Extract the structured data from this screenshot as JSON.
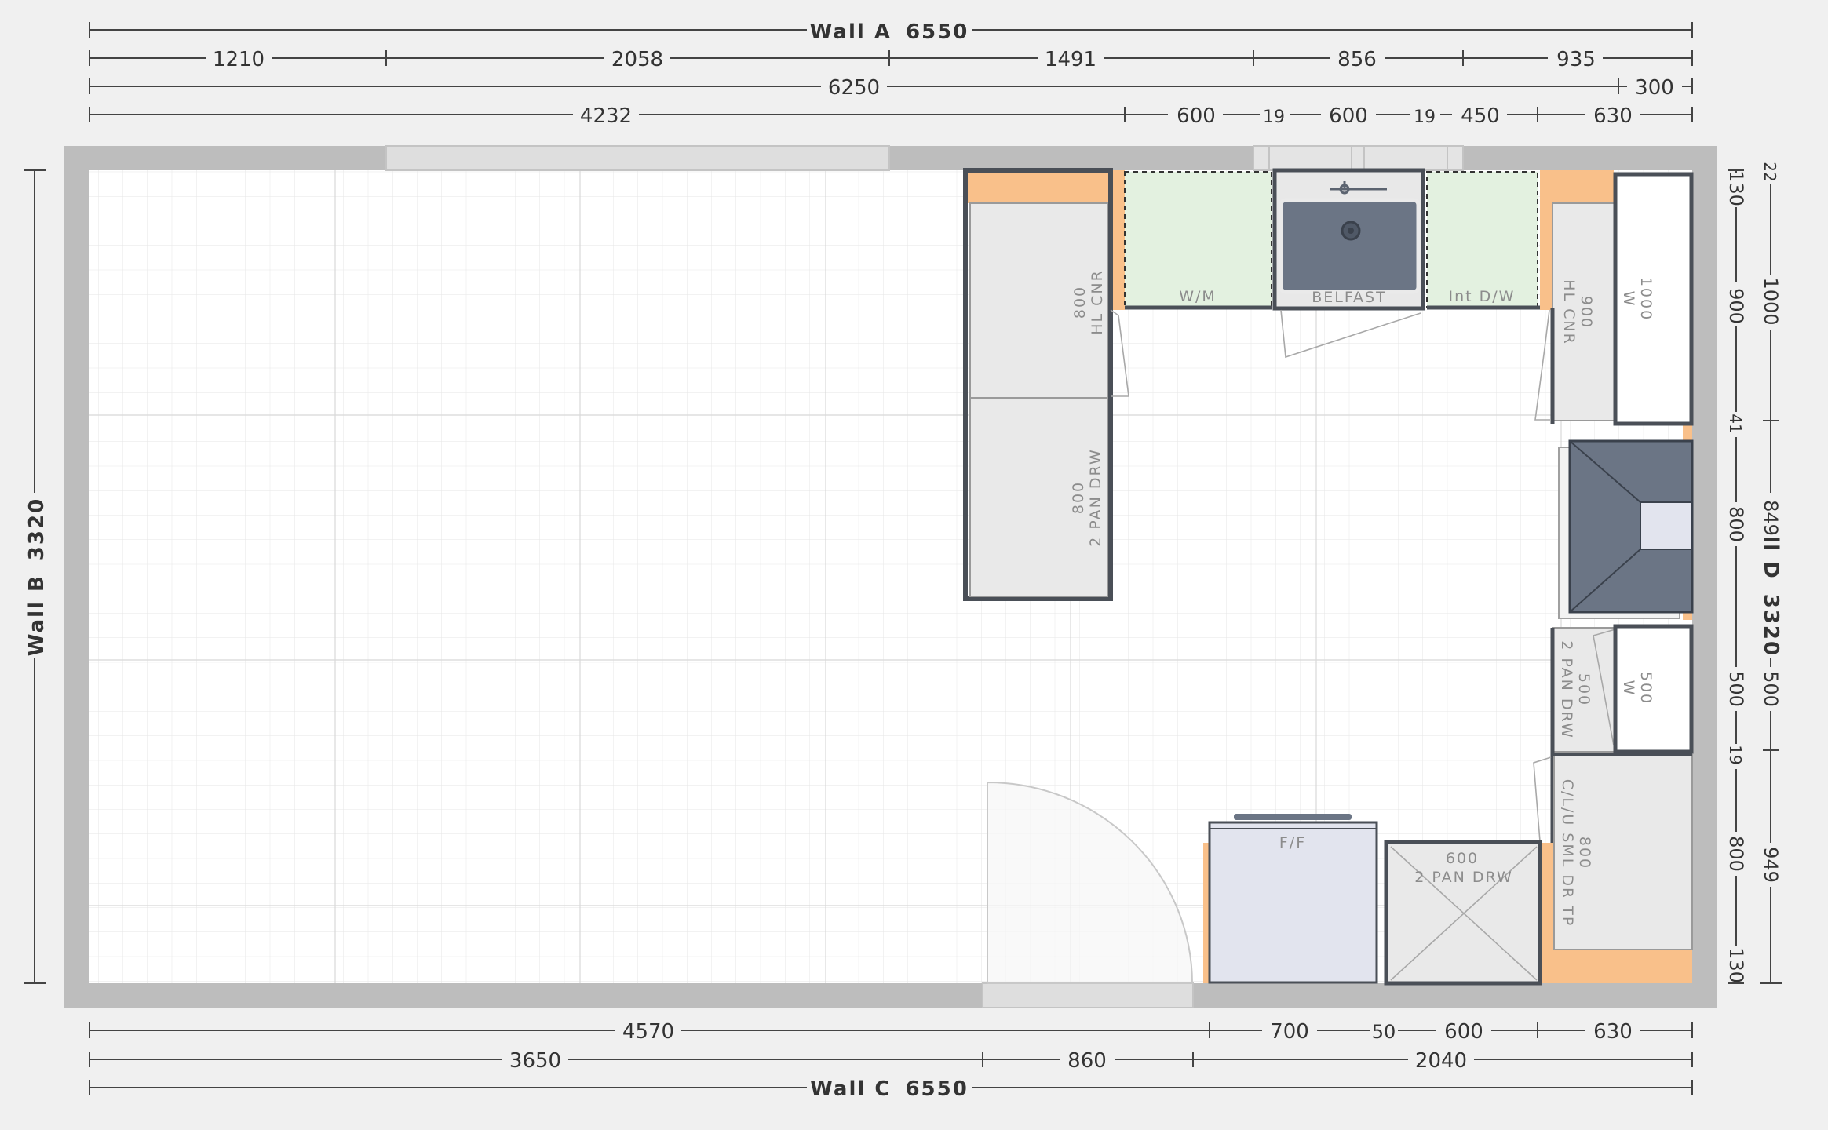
{
  "walls": {
    "a": {
      "name": "Wall A",
      "length": "6550"
    },
    "b": {
      "name": "Wall B",
      "length": "3320"
    },
    "c": {
      "name": "Wall C",
      "length": "6550"
    },
    "d": {
      "name": "Wall D",
      "length": "3320"
    }
  },
  "dims": {
    "top_row1": [
      "1210",
      "2058",
      "1491",
      "856",
      "935"
    ],
    "top_row2": [
      "6250",
      "300"
    ],
    "top_row3": [
      "4232",
      "600",
      "19",
      "600",
      "19",
      "450",
      "630"
    ],
    "bottom_row1": [
      "4570",
      "700",
      "50",
      "600",
      "630"
    ],
    "bottom_row2": [
      "3650",
      "860",
      "2040"
    ],
    "right_inner": [
      "130",
      "900",
      "41",
      "800",
      "500",
      "19",
      "800",
      "130"
    ],
    "right_outer": [
      "22",
      "1000",
      "849",
      "500",
      "949"
    ]
  },
  "units": {
    "hl_cnr_left": {
      "w": "800",
      "t": "HL CNR"
    },
    "pan_drw_left": {
      "w": "800",
      "t": "2 PAN DRW"
    },
    "washer": {
      "t": "W/M"
    },
    "sink": {
      "t": "BELFAST"
    },
    "dishwasher": {
      "t": "Int D/W"
    },
    "hl_cnr_right": {
      "w": "900",
      "t": "HL CNR"
    },
    "wall_1000": {
      "w": "1000",
      "t": "W"
    },
    "pan_drw_right": {
      "w": "500",
      "t": "2 PAN DRW"
    },
    "wall_500": {
      "w": "500",
      "t": "W"
    },
    "clu": {
      "w": "800",
      "t": "C/L/U SML DR TP"
    },
    "fridge": {
      "t": "F/F"
    },
    "pan_drw_bottom": {
      "w": "600",
      "t": "2 PAN DRW"
    }
  },
  "colors": {
    "wall": "#bdbdbd",
    "worktop": "#f9c08a",
    "unit": "#e9e9e9",
    "appliance_green": "#e3f1e0",
    "hob": "#6b7585",
    "fridge": "#e2e4ee"
  }
}
